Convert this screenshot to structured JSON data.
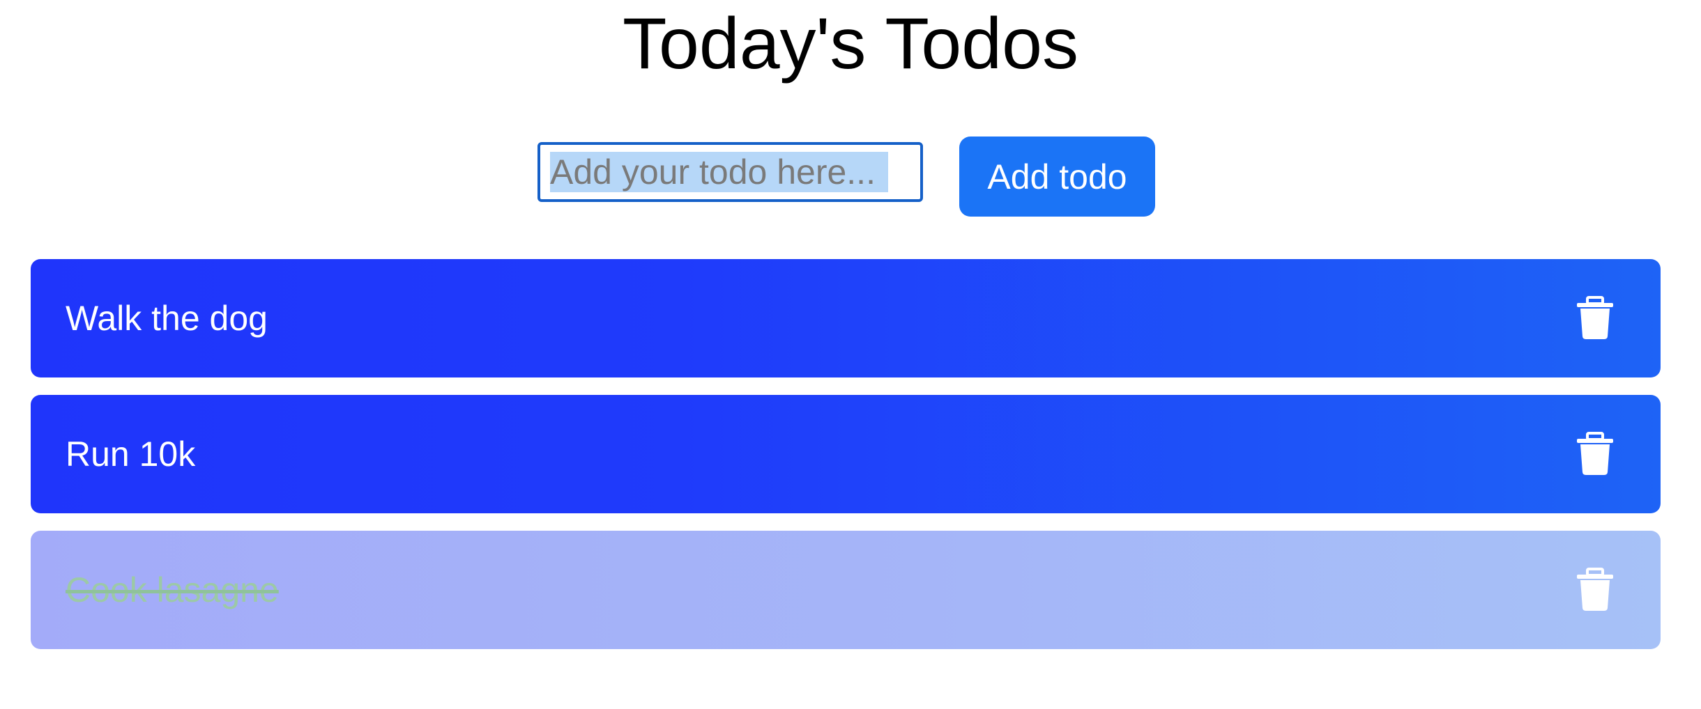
{
  "page": {
    "title": "Today's Todos"
  },
  "form": {
    "input_placeholder": "Add your todo here...",
    "input_value": "",
    "add_button_label": "Add todo"
  },
  "todos": [
    {
      "text": "Walk the dog",
      "completed": false,
      "delete_icon": "trash-icon"
    },
    {
      "text": "Run 10k",
      "completed": false,
      "delete_icon": "trash-icon"
    },
    {
      "text": "Cook lasagne",
      "completed": true,
      "delete_icon": "trash-icon"
    }
  ],
  "colors": {
    "accent": "#1b74f6",
    "item_gradient_start": "#1f35fb",
    "item_gradient_end": "#1e63f6",
    "completed_text": "#9cc9a6"
  }
}
